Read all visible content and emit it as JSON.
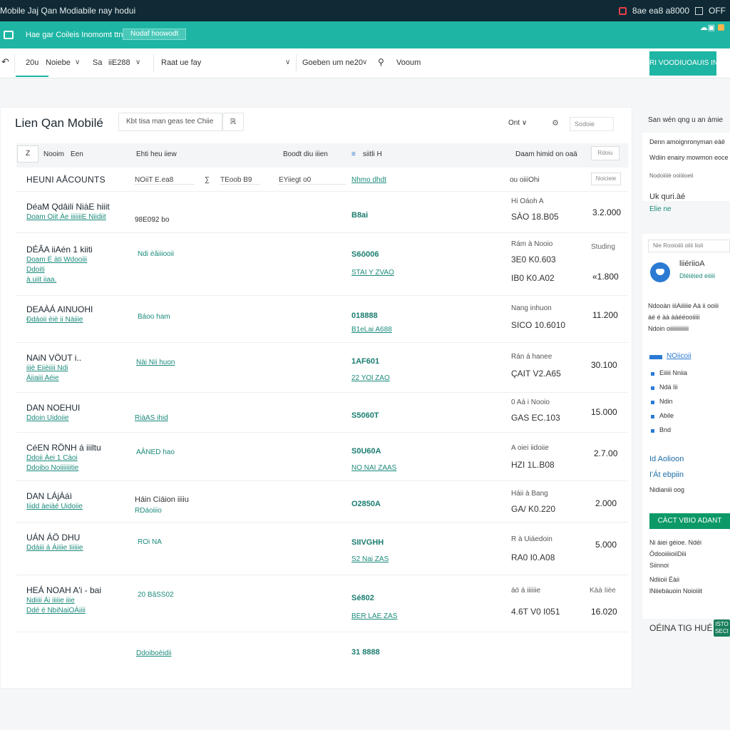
{
  "topbar": {
    "title": "Mobile Jaj Qan Modiabile nay hodui",
    "right_text": "8ae ea8 a8000",
    "right_end": "OFF",
    "accent": "#0f2a35"
  },
  "tealbar": {
    "breadcrumb": "Hae gar Coileis Inomomt ttn",
    "chip": "Nodaf hoowodt",
    "corner": "☁▣",
    "accent": "#1fb5a4"
  },
  "filters": {
    "range_label": "20u",
    "range_value": "Noiebe",
    "field2_icon": "⇥",
    "field2_label": "Sa",
    "field2_value": "iiE288",
    "field3": "Raat ue fay",
    "field4": "Goeben um ne20",
    "field5": "Vooum",
    "cta": "RI VOODIUOAUIS IN"
  },
  "main": {
    "title": "Lien Qan Mobilé",
    "search_placeholder": "Kbt tisa man geas tee Chiie",
    "search_btn": "ℝ",
    "sort_label": "Ont",
    "sort_chev": "∨",
    "view_placeholder": "Sodoie"
  },
  "table": {
    "headers": {
      "select": "Z",
      "col1": "Nooim",
      "col2": "Een",
      "col3": "Ehti heu iiew",
      "col4": "Boodt diu iiien",
      "col5_icon": "≡",
      "col5": "siitli H",
      "col6": "Daam himid on oaä",
      "col7": "Rdoiu"
    },
    "subheader": {
      "title": "HEUNI AÅCOUNTS",
      "a": "NOiiT E.ea8",
      "b": "∑",
      "c": "TEoob B9",
      "d": "EYiiegt o0",
      "e": "Nhmo dhdt",
      "f": "ou oiiiOhi",
      "g": "Noicieie"
    },
    "rows": [
      {
        "name": "DéaM Qdâili NiàE hiiit",
        "sub": "Doam Oiit Àe iiiiiiiE Niidiit",
        "sub2": "",
        "sub3": "",
        "mid": "",
        "code": "",
        "code_top": "98E092 bo",
        "code2": "B8ai",
        "code2sub": "",
        "dt1": "Hi Oáoh A",
        "dt2": "SÀO 18.B05",
        "price": "3.2.000",
        "status": ""
      },
      {
        "name": "DÉÂA iiAén 1 kiiti",
        "sub": "Doam É àti Wdooiii",
        "sub2": "Ddoiti",
        "sub3": "à.uiit iiaa.",
        "mid": "Ndi èâiiiooii",
        "code": "S6ô006",
        "code2": "STAI Y ZVAO",
        "dt1": "Rám à Nooio",
        "dt2": "3E0 K0.603",
        "dt3": "IB0 K0.A02",
        "price": "«1.800",
        "status": "Studing"
      },
      {
        "name": "DEAÀÁ AINUOHI",
        "sub": "Ðdáoii èiè ii Nàiiie",
        "mid": "Báoo ham",
        "code": "018888",
        "code2": "B1eLai A688",
        "dt1": "Nang inhuon",
        "dt2": "SICO 10.6010",
        "price": "11.200"
      },
      {
        "name": "NAiN VÖUT i..",
        "sub": "iiiè Eiièiiii Ndi",
        "sub2": "Áiiaiii Aéie",
        "mid": "Nài Nii huon",
        "code": "1AF601",
        "code2": "22 YOl ZAO",
        "dt1": "Rán á hanee",
        "dt2": "ÇAIT V2.A65",
        "price": "30.100"
      },
      {
        "name": "DAN NOEHUI",
        "sub": "Ddoin Uidoiie",
        "mid": "RiàAS ihid",
        "code": "S5060T",
        "dt1": "0 Aá i Nooio",
        "dt2": "GAS EC.103",
        "price": "15.000"
      },
      {
        "name": "CéEN RÖNH á iiiltu",
        "sub": "Ddoii Àei 1 Càoi",
        "sub2": "Ddoibo Noiiiiiiitie",
        "mid": "AÂNED hao",
        "code": "S0U60A",
        "code2": "NO NAI ZAAS",
        "dt1": "A oiei iidoiie",
        "dt2": "HZI 1L.B08",
        "price": "2.7.00"
      },
      {
        "name": "DAN LÁjÀáì",
        "sub": "Iiidd àeiàé Uidoiie",
        "mid": "Háin Ciáion iiiiu",
        "mid2": "RDáoiiio",
        "code": "O2850A",
        "dt1": "Háii à Bang",
        "dt2": "GA/ K0.220",
        "price": "2.000"
      },
      {
        "name": "UÁN ÁÖ DHU",
        "sub": "Ddáiii á Áiiiie Iiiiiie",
        "mid": "ROi NA",
        "code": "SIIVGHH",
        "code2": "S2 Nai ZAS",
        "dt1": "R à Uiáedoin",
        "dt2": "RA0 I0.A08",
        "price": "5.000"
      },
      {
        "name": "HEÁ NOAH A'i - bai",
        "sub": "Ndiiii Ái iiiiie iiie",
        "sub2": "Ddé é NbiNaiOÁiiii",
        "mid": "20 BâSS02",
        "code": "Sé802",
        "code2": "BER LAE ZAS",
        "dt1": "áö á iiiiiie",
        "dt2": "4.6T V0 I051",
        "price": "16.020",
        "status": "Kàà Iièe"
      },
      {
        "name": "",
        "sub": "",
        "mid": "Ddoiboèidii",
        "code": "31 8888",
        "dt1": "",
        "dt2": "",
        "price": ""
      }
    ]
  },
  "sidebar": {
    "header": "San wén qng u an ámie",
    "line1": "Denn amoignronyman eàë",
    "line2": "Wdiin enairy mowmon eoce",
    "line3": "Nodoiiiiè ooiiiioeii",
    "uk": "Uk quri.àé",
    "uk_sub": "Elie ne",
    "search_card": "Nie Rooioiiii oiiii Iioii",
    "avatar_name": "liiériioA",
    "avatar_sub": "Dléièied eiiiii",
    "desc1": "Ndooàn iiiAiiiiie Aà ii ooiii",
    "desc2": "áé é àà àáééooiiiii",
    "desc3": "Ndoin oiiiiiiiiiiiii",
    "menu_title": "NOiicoii",
    "menu": [
      "Eiiiii Nniia",
      "Ndá Iii",
      "Ndin",
      "Abile",
      "Bnd"
    ],
    "big1": "Id Aolioon",
    "big2": "I'Át ebpiin",
    "small": "Nidianiii oog",
    "cta": "CÀCT VBIO ADANT",
    "items": [
      "Ni àiei géioe. Ndéi",
      "ÓdooiiiioiiDiii",
      "Siinnoi",
      "Ndiioii Éàii",
      "lNiiebàuoin Noioiiit"
    ],
    "footer": "OÉINA TIG HUÉ",
    "badge": "ISTO SECI"
  }
}
